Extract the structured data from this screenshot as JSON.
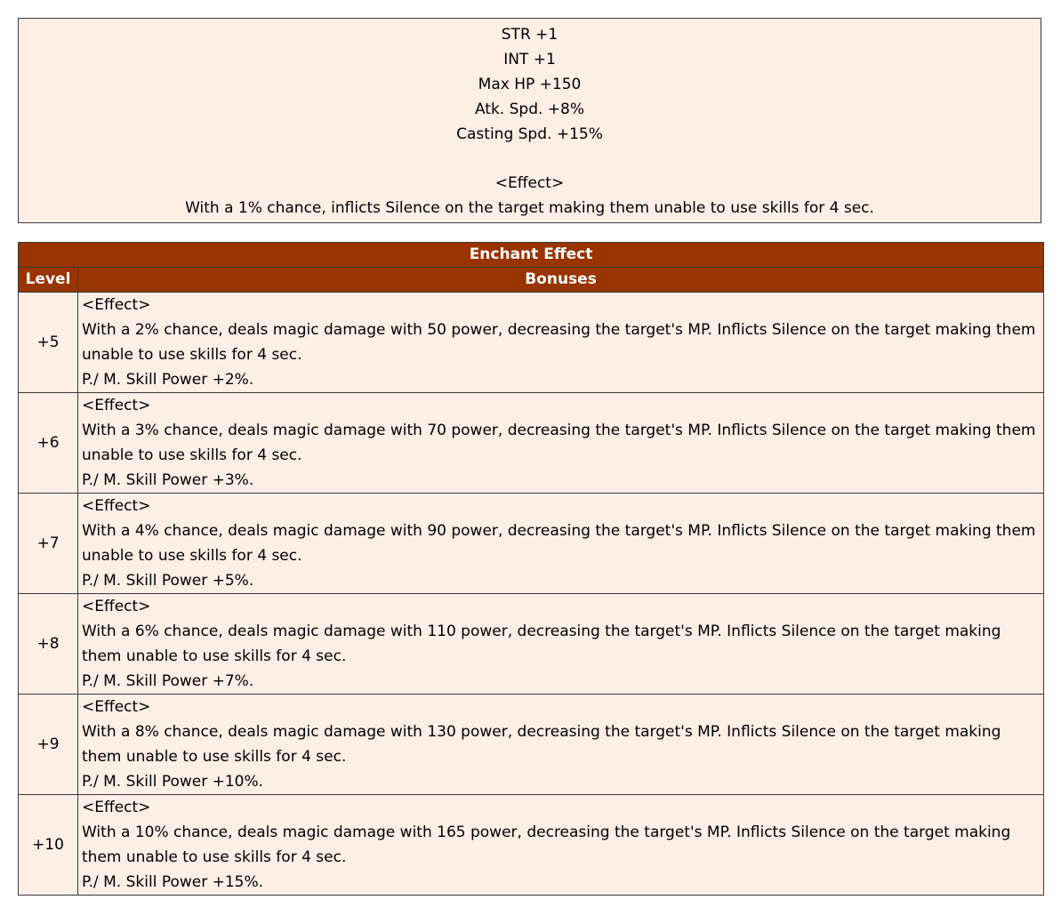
{
  "stats": {
    "lines": [
      "STR +1",
      "INT +1",
      "Max HP +150",
      "Atk. Spd. +8%",
      "Casting Spd. +15%",
      "",
      "<Effect>",
      "With a 1% chance, inflicts Silence on the target making them unable to use skills for 4 sec."
    ]
  },
  "enchant": {
    "title": "Enchant Effect",
    "headers": {
      "level": "Level",
      "bonuses": "Bonuses"
    },
    "rows": [
      {
        "level": "+5",
        "effect_label": "<Effect>",
        "description": "With a 2% chance, deals magic damage with 50 power, decreasing the target's MP. Inflicts Silence on the target making them unable to use skills for 4 sec.",
        "skill_power": "P./ M. Skill Power +2%."
      },
      {
        "level": "+6",
        "effect_label": "<Effect>",
        "description": "With a 3% chance, deals magic damage with 70 power, decreasing the target's MP. Inflicts Silence on the target making them unable to use skills for 4 sec.",
        "skill_power": "P./ M. Skill Power +3%."
      },
      {
        "level": "+7",
        "effect_label": "<Effect>",
        "description": "With a 4% chance, deals magic damage with 90 power, decreasing the target's MP. Inflicts Silence on the target making them unable to use skills for 4 sec.",
        "skill_power": "P./ M. Skill Power +5%."
      },
      {
        "level": "+8",
        "effect_label": "<Effect>",
        "description": "With a 6% chance, deals magic damage with 110 power, decreasing the target's MP. Inflicts Silence on the target making them unable to use skills for 4 sec.",
        "skill_power": "P./ M. Skill Power +7%."
      },
      {
        "level": "+9",
        "effect_label": "<Effect>",
        "description": "With a 8% chance, deals magic damage with 130 power, decreasing the target's MP. Inflicts Silence on the target making them unable to use skills for 4 sec.",
        "skill_power": "P./ M. Skill Power +10%."
      },
      {
        "level": "+10",
        "effect_label": "<Effect>",
        "description": "With a 10% chance, deals magic damage with 165 power, decreasing the target's MP. Inflicts Silence on the target making them unable to use skills for 4 sec.",
        "skill_power": "P./ M. Skill Power +15%."
      }
    ]
  },
  "colors": {
    "header_bg": "#993300",
    "header_text": "#ffffff",
    "cell_bg": "#fdeee6",
    "border": "#3a3a3a"
  }
}
